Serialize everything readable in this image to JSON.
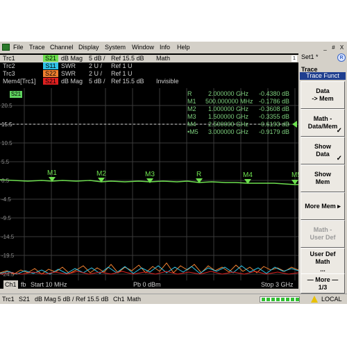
{
  "menubar": {
    "items": [
      "File",
      "Trace",
      "Channel",
      "Display",
      "System",
      "Window",
      "Info",
      "Help"
    ]
  },
  "trace_list": {
    "rows": [
      {
        "name": "Trc1",
        "param": "S21",
        "param_color": "#6ee04f",
        "format": "dB Mag",
        "scale": "5 dB /",
        "ref": "Ref 15.5 dB",
        "status": "Math",
        "selected": true
      },
      {
        "name": "Trc2",
        "param": "S11",
        "param_color": "#2ec4e8",
        "format": "SWR",
        "scale": "2 U /",
        "ref": "Ref 1 U",
        "status": "",
        "selected": false
      },
      {
        "name": "Trc3",
        "param": "S22",
        "param_color": "#f08030",
        "format": "SWR",
        "scale": "2 U /",
        "ref": "Ref 1 U",
        "status": "",
        "selected": false
      },
      {
        "name": "Mem4[Trc1]",
        "param": "S21",
        "param_color": "#e02020",
        "format": "dB Mag",
        "scale": "5 dB /",
        "ref": "Ref 15.5 dB",
        "status": "Invisible",
        "selected": false
      }
    ],
    "scroll_number": "1"
  },
  "diagram": {
    "trace_badge": "S21",
    "ref_value": "15.5",
    "y_ticks": [
      "20.5",
      "15.5",
      "10.5",
      "5.5",
      "0.5",
      "-4.5",
      "-9.5",
      "-14.5",
      "-19.5",
      "-24.5"
    ],
    "markers": [
      {
        "name": "R",
        "freq": "2.000000 GHz",
        "value": "-0.4380 dB"
      },
      {
        "name": "M1",
        "freq": "500.000000 MHz",
        "value": "-0.1786 dB"
      },
      {
        "name": "M2",
        "freq": "1.000000 GHz",
        "value": "-0.3608 dB"
      },
      {
        "name": "M3",
        "freq": "1.500000 GHz",
        "value": "-0.3355 dB"
      },
      {
        "name": "M4",
        "freq": "2.500000 GHz",
        "value": "-0.6193 dB"
      },
      {
        "name": "•M5",
        "freq": "3.000000 GHz",
        "value": "-0.9179 dB"
      }
    ],
    "marker_labels": [
      "M1",
      "M2",
      "M3",
      "R",
      "M4",
      "M5"
    ]
  },
  "channel_bar": {
    "channel": "Ch1",
    "mode": "fb",
    "start": "Start  10 MHz",
    "power": "Pb   0 dBm",
    "stop": "Stop  3 GHz"
  },
  "status_bar": {
    "trace": "Trc1",
    "param": "S21",
    "format": "dB Mag",
    "scale": "5 dB / Ref 15.5 dB",
    "channel": "Ch1",
    "math": "Math",
    "local": "LOCAL"
  },
  "right_panel": {
    "set_label": "Set1 *",
    "logo": "R",
    "title": "Trace",
    "subtitle": "Trace Funct",
    "window_controls": [
      "_",
      "#",
      "X"
    ],
    "buttons": [
      {
        "l1": "Data",
        "l2": "-> Mem",
        "l3": "",
        "checked": false,
        "enabled": true
      },
      {
        "l1": "Math -",
        "l2": "Data/Mem",
        "l3": "",
        "checked": true,
        "enabled": true
      },
      {
        "l1": "Show",
        "l2": "Data",
        "l3": "",
        "checked": true,
        "enabled": true
      },
      {
        "l1": "Show",
        "l2": "Mem",
        "l3": "",
        "checked": false,
        "enabled": true
      },
      {
        "l1": "More Mem ▸",
        "l2": "",
        "l3": "",
        "checked": false,
        "enabled": true
      },
      {
        "l1": "Math -",
        "l2": "User Def",
        "l3": "",
        "checked": false,
        "enabled": false
      },
      {
        "l1": "User Def",
        "l2": "Math",
        "l3": "...",
        "checked": false,
        "enabled": true
      },
      {
        "l1": "— More —",
        "l2": "1/3",
        "l3": "",
        "checked": false,
        "enabled": true
      }
    ]
  }
}
